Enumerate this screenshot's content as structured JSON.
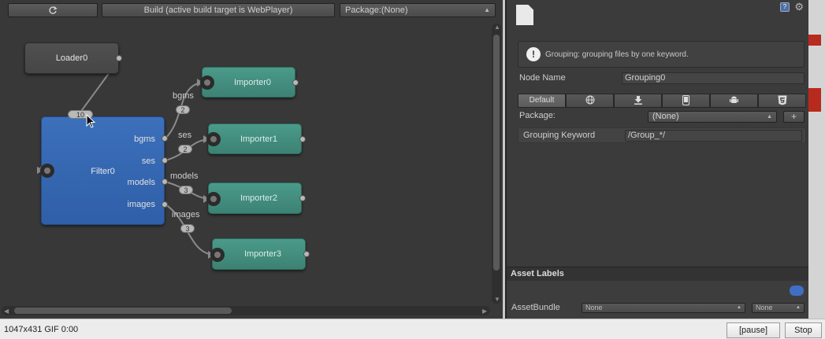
{
  "graph": {
    "toolbar": {
      "refresh_icon": "refresh-icon",
      "build_label": "Build (active build target is WebPlayer)",
      "package_select": "Package:(None)"
    },
    "nodes": {
      "loader": "Loader0",
      "filter": "Filter0",
      "importers": [
        "Importer0",
        "Importer1",
        "Importer2",
        "Importer3"
      ]
    },
    "filter_ports": [
      "bgms",
      "ses",
      "models",
      "images"
    ],
    "edges": [
      {
        "label": "",
        "count": "10"
      },
      {
        "label": "bgms",
        "count": "2"
      },
      {
        "label": "ses",
        "count": "2"
      },
      {
        "label": "models",
        "count": "3"
      },
      {
        "label": "images",
        "count": "3"
      }
    ]
  },
  "inspector": {
    "help_text": "Grouping: grouping files by one keyword.",
    "node_name_label": "Node Name",
    "node_name_value": "Grouping0",
    "platform_tabs": [
      "Default",
      "globe-icon",
      "download-icon",
      "mobile-icon",
      "android-icon",
      "html5-icon"
    ],
    "active_tab": "Default",
    "package_label": "Package:",
    "package_value": "(None)",
    "plus_label": "+",
    "keyword_label": "Grouping Keyword",
    "keyword_value": "/Group_*/",
    "asset_labels_title": "Asset Labels",
    "assetbundle_label": "AssetBundle",
    "assetbundle_name": "None",
    "assetbundle_variant": "None"
  },
  "bottom_bar": {
    "info": "1047x431 GIF 0:00",
    "pause_label": "[pause]",
    "stop_label": "Stop"
  },
  "colors": {
    "filter_node": "#3567b3",
    "importer_node": "#44907f",
    "loader_node": "#4a4a4a",
    "edge_strip_red": "#b82a1e"
  }
}
